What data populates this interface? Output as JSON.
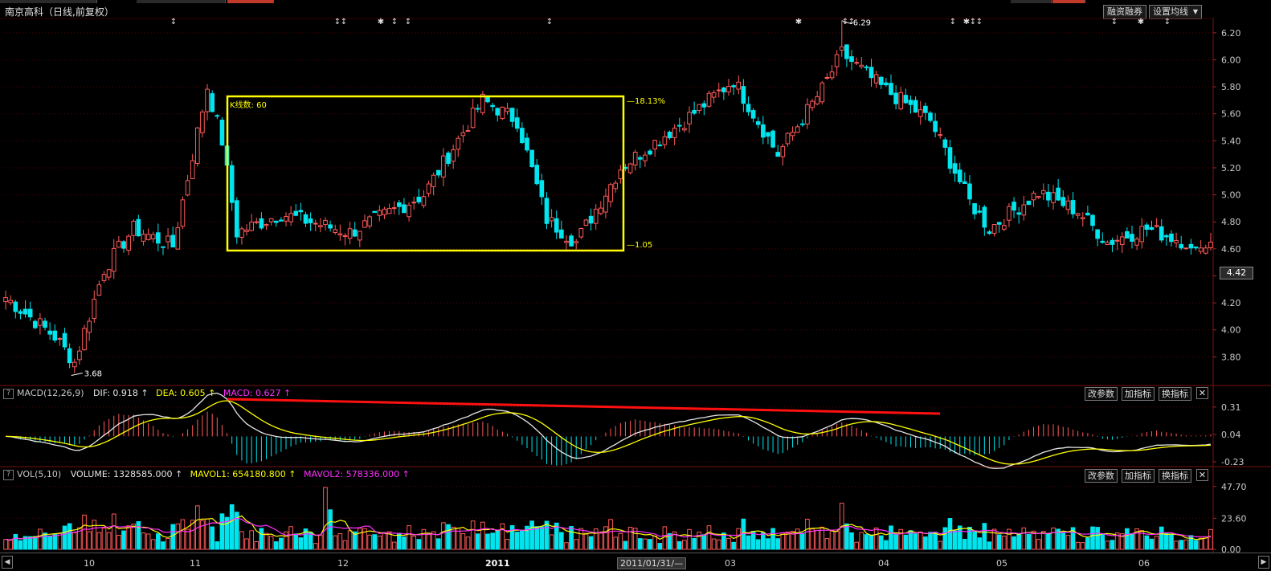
{
  "window": {
    "title": "南京高科（日线,前复权）"
  },
  "toolbar": {
    "margin_label": "融资融券",
    "ma_setting_label": "设置均线"
  },
  "current_price_label": "4.42",
  "selection_box": {
    "label": "K线数: 60",
    "top_pct": "18.13%",
    "bottom_label": "1.05"
  },
  "annotations": {
    "low": "3.68",
    "high": "6.29"
  },
  "macd_header": {
    "name": "MACD(12,26,9)",
    "dif": "DIF: 0.918",
    "dea": "DEA: 0.605",
    "macd": "MACD: 0.627"
  },
  "vol_header": {
    "name": "VOL(5,10)",
    "volume": "VOLUME: 1328585.000",
    "mavol1": "MAVOL1: 654180.800",
    "mavol2": "MAVOL2: 578336.000"
  },
  "panel_buttons": {
    "params": "改参数",
    "add": "加指标",
    "swap": "换指标",
    "close": "✕"
  },
  "bottom": {
    "date_readout": "2011/01/31/—",
    "x_labels": [
      "10",
      "11",
      "12",
      "2011",
      "03",
      "04",
      "05",
      "06"
    ]
  },
  "colors": {
    "up": "#ff5a5a",
    "down": "#00e5ee",
    "yellow": "#ffff00",
    "white": "#e6e6e6",
    "magenta": "#ff30ff",
    "grid": "#5a0000"
  },
  "chart_data": [
    {
      "type": "candlestick",
      "title": "南京高科（日线,前复权）",
      "ylim": [
        3.6,
        6.3
      ],
      "y_ticks": [
        "6.20",
        "6.00",
        "5.80",
        "5.60",
        "5.40",
        "5.20",
        "5.00",
        "4.80",
        "4.60",
        "4.40",
        "4.20",
        "4.00",
        "3.80"
      ],
      "x_labels": [
        "10",
        "11",
        "12",
        "2011",
        "03",
        "04",
        "05",
        "06"
      ],
      "annotated_low": 3.68,
      "annotated_high": 6.29,
      "last_price": 4.42,
      "anchors": [
        {
          "i": 0,
          "price": 4.24
        },
        {
          "i": 10,
          "price": 3.95
        },
        {
          "i": 14,
          "price": 3.76
        },
        {
          "i": 20,
          "price": 4.45
        },
        {
          "i": 26,
          "price": 4.75
        },
        {
          "i": 34,
          "price": 4.62
        },
        {
          "i": 41,
          "price": 5.8
        },
        {
          "i": 44,
          "price": 5.4
        },
        {
          "i": 47,
          "price": 4.72
        },
        {
          "i": 56,
          "price": 4.86
        },
        {
          "i": 70,
          "price": 4.72
        },
        {
          "i": 85,
          "price": 5.0
        },
        {
          "i": 97,
          "price": 5.7
        },
        {
          "i": 104,
          "price": 5.55
        },
        {
          "i": 110,
          "price": 4.82
        },
        {
          "i": 116,
          "price": 4.65
        },
        {
          "i": 125,
          "price": 5.2
        },
        {
          "i": 138,
          "price": 5.55
        },
        {
          "i": 148,
          "price": 5.85
        },
        {
          "i": 157,
          "price": 5.3
        },
        {
          "i": 166,
          "price": 5.78
        },
        {
          "i": 170,
          "price": 6.05
        },
        {
          "i": 178,
          "price": 5.8
        },
        {
          "i": 188,
          "price": 5.55
        },
        {
          "i": 196,
          "price": 4.95
        },
        {
          "i": 200,
          "price": 4.75
        },
        {
          "i": 210,
          "price": 5.02
        },
        {
          "i": 218,
          "price": 4.88
        },
        {
          "i": 224,
          "price": 4.65
        },
        {
          "i": 232,
          "price": 4.75
        },
        {
          "i": 240,
          "price": 4.65
        }
      ]
    },
    {
      "type": "line",
      "title": "MACD(12,26,9)",
      "y_ticks": [
        "0.31",
        "0.04",
        "-0.23"
      ],
      "ylim": [
        -0.27,
        0.38
      ],
      "series": [
        {
          "name": "DIF",
          "color": "#e6e6e6"
        },
        {
          "name": "DEA",
          "color": "#ffff00"
        },
        {
          "name": "MACD",
          "color": "#ff30ff"
        }
      ]
    },
    {
      "type": "bar",
      "title": "VOL(5,10)",
      "y_ticks": [
        "47.70",
        "23.60",
        "0.00"
      ],
      "ylim": [
        0,
        50
      ],
      "series": [
        {
          "name": "MAVOL1",
          "color": "#ffff00"
        },
        {
          "name": "MAVOL2",
          "color": "#ff30ff"
        }
      ]
    }
  ]
}
